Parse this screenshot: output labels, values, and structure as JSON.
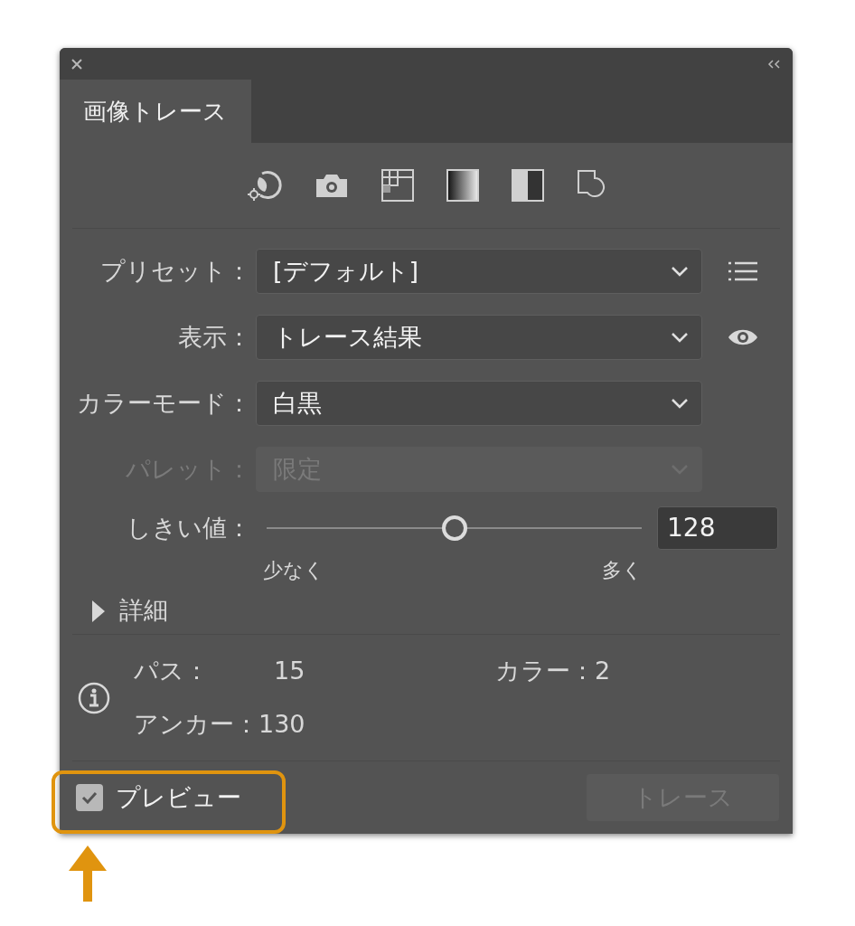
{
  "tabs": [
    {
      "label": "画像トレース",
      "selected": true
    }
  ],
  "fields": [
    {
      "label": "プリセット：",
      "value": "[デフォルト]",
      "disabled": false
    },
    {
      "label": "表示：",
      "value": "トレース結果",
      "disabled": false
    },
    {
      "label": "カラーモード：",
      "value": "白黒",
      "disabled": false
    },
    {
      "label": "パレット：",
      "value": "限定",
      "disabled": true
    }
  ],
  "threshold": {
    "label": "しきい値：",
    "level": 0.5,
    "value": "128",
    "min_label": "少なく",
    "max_label": "多く"
  },
  "details": {
    "label": "詳細",
    "expanded": false
  },
  "info": [
    {
      "label": "パス：",
      "value": "15"
    },
    {
      "label": "カラー：",
      "value": "2"
    },
    {
      "label": "アンカー：",
      "value": "130"
    }
  ],
  "preview": {
    "label": "プレビュー",
    "checked": true,
    "highlighted": true
  },
  "trace_button": {
    "label": "トレース",
    "disabled": true
  }
}
